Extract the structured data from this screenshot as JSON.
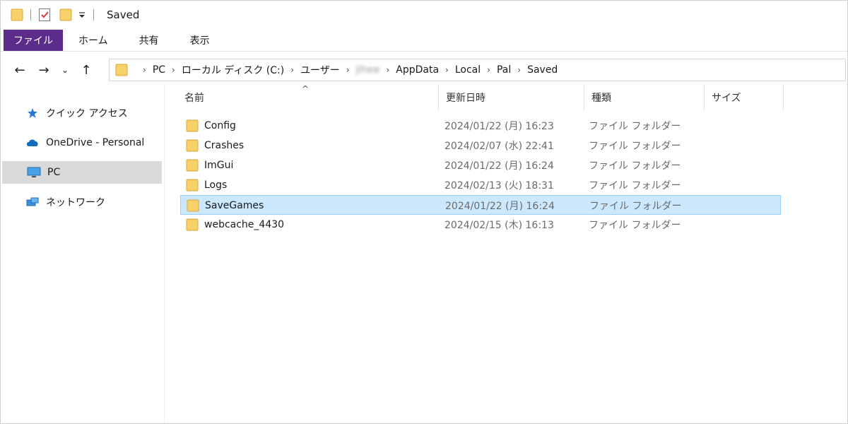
{
  "window": {
    "title": "Saved",
    "quick_access": [
      "folder-icon",
      "properties-check-icon",
      "new-folder-icon",
      "customize-dropdown-icon"
    ]
  },
  "ribbon": {
    "tabs": [
      {
        "label": "ファイル",
        "active": true
      },
      {
        "label": "ホーム"
      },
      {
        "label": "共有"
      },
      {
        "label": "表示"
      }
    ],
    "file_tab_color": "#5b2c8a"
  },
  "nav": {
    "back": "←",
    "forward": "→",
    "recent": "⌄",
    "up": "↑"
  },
  "address": {
    "crumbs": [
      "PC",
      "ローカル ディスク (C:)",
      "ユーザー",
      "jihee",
      "AppData",
      "Local",
      "Pal",
      "Saved"
    ]
  },
  "sidebar": {
    "items": [
      {
        "label": "クイック アクセス",
        "icon": "star-icon"
      },
      {
        "label": "OneDrive - Personal",
        "icon": "cloud-icon"
      },
      {
        "label": "PC",
        "icon": "monitor-icon",
        "selected": true
      },
      {
        "label": "ネットワーク",
        "icon": "network-icon"
      }
    ]
  },
  "columns": {
    "name": "名前",
    "modified": "更新日時",
    "type": "種類",
    "size": "サイズ",
    "sort_indicator": "^"
  },
  "files": [
    {
      "name": "Config",
      "modified": "2024/01/22 (月) 16:23",
      "type": "ファイル フォルダー"
    },
    {
      "name": "Crashes",
      "modified": "2024/02/07 (水) 22:41",
      "type": "ファイル フォルダー"
    },
    {
      "name": "ImGui",
      "modified": "2024/01/22 (月) 16:24",
      "type": "ファイル フォルダー"
    },
    {
      "name": "Logs",
      "modified": "2024/02/13 (火) 18:31",
      "type": "ファイル フォルダー"
    },
    {
      "name": "SaveGames",
      "modified": "2024/01/22 (月) 16:24",
      "type": "ファイル フォルダー",
      "selected": true
    },
    {
      "name": "webcache_4430",
      "modified": "2024/02/15 (木) 16:13",
      "type": "ファイル フォルダー"
    }
  ],
  "colors": {
    "selection_bg": "#cce8ff",
    "selection_border": "#99d1ff",
    "folder_yellow": "#f7d26a",
    "nav_selected_bg": "#d9d9d9"
  }
}
